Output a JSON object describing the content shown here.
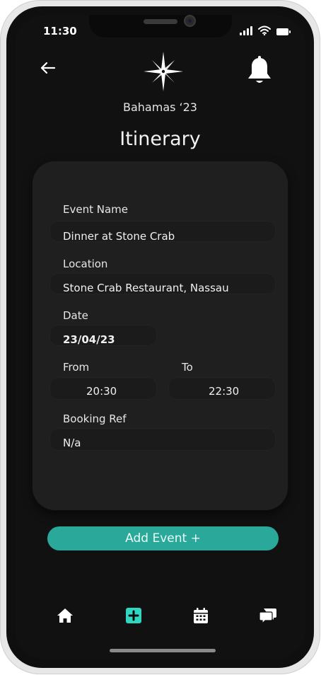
{
  "status_bar": {
    "time": "11:30"
  },
  "header": {
    "trip_name": "Bahamas ‘23",
    "title": "Itinerary"
  },
  "form": {
    "event_name": {
      "label": "Event Name",
      "value": "Dinner at Stone Crab"
    },
    "location": {
      "label": "Location",
      "value": "Stone Crab Restaurant, Nassau"
    },
    "date": {
      "label": "Date",
      "value": "23/04/23"
    },
    "from": {
      "label": "From",
      "value": "20:30"
    },
    "to": {
      "label": "To",
      "value": "22:30"
    },
    "booking_ref": {
      "label": "Booking Ref",
      "value": "N/a"
    }
  },
  "actions": {
    "add_event_label": "Add Event +"
  },
  "nav": {
    "items": [
      {
        "icon": "home-icon"
      },
      {
        "icon": "plus-square-icon",
        "active": true
      },
      {
        "icon": "calendar-icon"
      },
      {
        "icon": "chat-icon"
      }
    ]
  },
  "colors": {
    "accent": "#2aa99a",
    "background": "#111111",
    "card": "#1f1f1f"
  }
}
